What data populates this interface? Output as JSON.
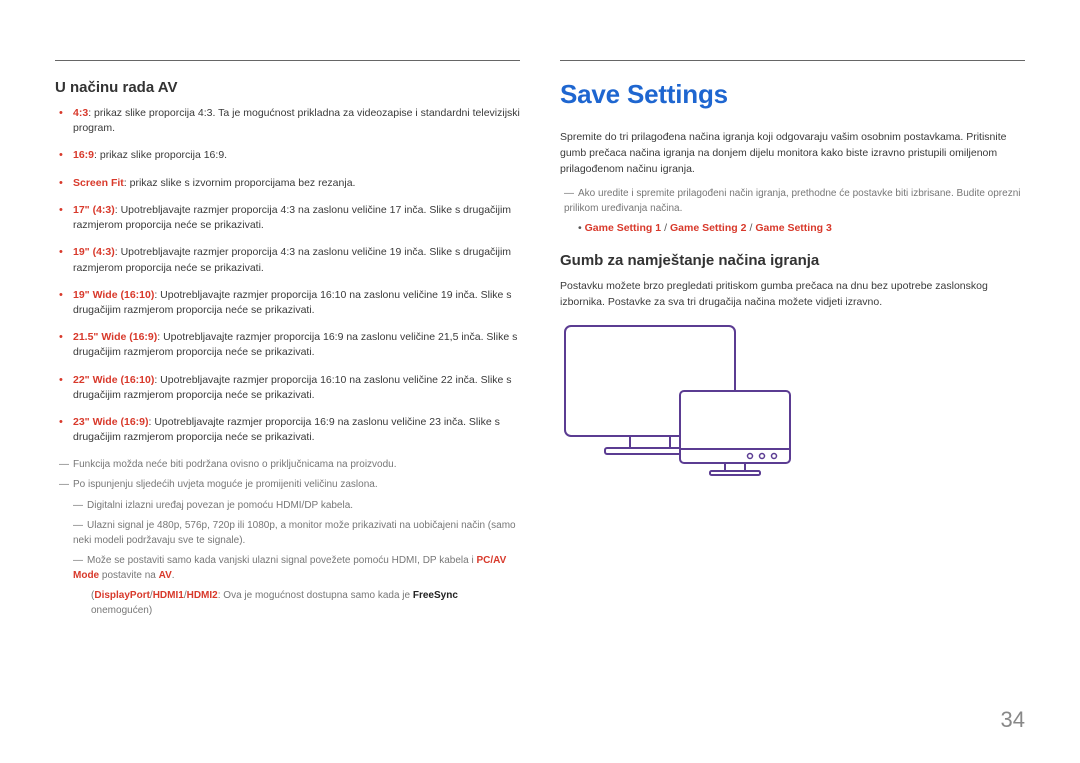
{
  "left": {
    "heading": "U načinu rada AV",
    "items": [
      {
        "label": "4:3",
        "text": ": prikaz slike proporcija 4:3. Ta je mogućnost prikladna za videozapise i standardni televizijski program."
      },
      {
        "label": "16:9",
        "text": ": prikaz slike proporcija 16:9."
      },
      {
        "label": "Screen Fit",
        "text": ": prikaz slike s izvornim proporcijama bez rezanja."
      },
      {
        "label": "17\" (4:3)",
        "text": ": Upotrebljavajte razmjer proporcija 4:3 na zaslonu veličine 17 inča. Slike s drugačijim razmjerom proporcija neće se prikazivati."
      },
      {
        "label": "19\" (4:3)",
        "text": ": Upotrebljavajte razmjer proporcija 4:3 na zaslonu veličine 19 inča. Slike s drugačijim razmjerom proporcija neće se prikazivati."
      },
      {
        "label": "19\" Wide (16:10)",
        "text": ": Upotrebljavajte razmjer proporcija 16:10 na zaslonu veličine 19 inča. Slike s drugačijim razmjerom proporcija neće se prikazivati."
      },
      {
        "label": "21.5\" Wide (16:9)",
        "text": ": Upotrebljavajte razmjer proporcija 16:9 na zaslonu veličine 21,5 inča. Slike s drugačijim razmjerom proporcija neće se prikazivati."
      },
      {
        "label": "22\" Wide (16:10)",
        "text": ": Upotrebljavajte razmjer proporcija 16:10 na zaslonu veličine 22 inča. Slike s drugačijim razmjerom proporcija neće se prikazivati."
      },
      {
        "label": "23\" Wide (16:9)",
        "text": ": Upotrebljavajte razmjer proporcija 16:9 na zaslonu veličine 23 inča. Slike s drugačijim razmjerom proporcija neće se prikazivati."
      }
    ],
    "notes": {
      "n1": "Funkcija možda neće biti podržana ovisno o priključnicama na proizvodu.",
      "n2": "Po ispunjenju sljedećih uvjeta moguće je promijeniti veličinu zaslona.",
      "n3": "Digitalni izlazni uređaj povezan je pomoću HDMI/DP kabela.",
      "n4": "Ulazni signal je 480p, 576p, 720p ili 1080p, a monitor može prikazivati na uobičajeni način (samo neki modeli podržavaju sve te signale).",
      "n5_pre": "Može se postaviti samo kada vanjski ulazni signal povežete pomoću HDMI, DP kabela i ",
      "n5_pcav": "PC/AV Mode",
      "n5_mid": " postavite na ",
      "n5_av": "AV",
      "n5_post": ".",
      "n6_dp": "DisplayPort",
      "n6_h1": "HDMI1",
      "n6_h2": "HDMI2",
      "n6_mid": ": Ova je mogućnost dostupna samo kada je ",
      "n6_fs": "FreeSync",
      "n6_post": " onemogućen)"
    }
  },
  "right": {
    "heading": "Save Settings",
    "para1": "Spremite do tri prilagođena načina igranja koji odgovaraju vašim osobnim postavkama. Pritisnite gumb prečaca načina igranja na donjem dijelu monitora kako biste izravno pristupili omiljenom prilagođenom načinu igranja.",
    "note1": "Ako uredite i spremite prilagođeni način igranja, prethodne će postavke biti izbrisane. Budite oprezni prilikom uređivanja načina.",
    "opt_bullet": "•",
    "opt1": "Game Setting 1",
    "opt2": "Game Setting 2",
    "opt3": "Game Setting 3",
    "sub_heading": "Gumb za namještanje načina igranja",
    "para2": "Postavku možete brzo pregledati pritiskom gumba prečaca na dnu bez upotrebe zaslonskog izbornika. Postavke za sva tri drugačija načina možete vidjeti izravno."
  },
  "page_number": "34"
}
